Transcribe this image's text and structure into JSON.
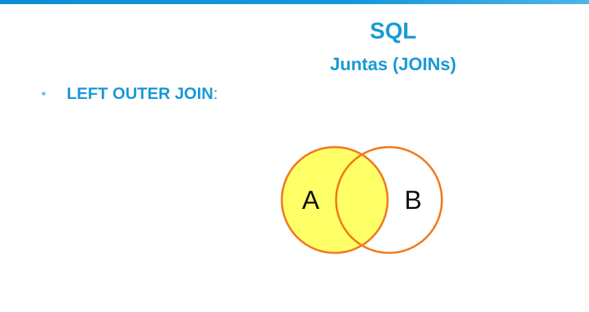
{
  "slide": {
    "title": "SQL",
    "subtitle": "Juntas (JOINs)",
    "bullet": {
      "marker": "•",
      "label": "LEFT OUTER JOIN",
      "suffix": ":"
    }
  },
  "diagram": {
    "set_a_label": "A",
    "set_b_label": "B",
    "highlighted": "A",
    "colors": {
      "fill_highlight": "#ffff66",
      "outline": "#f07a1e",
      "accent": "#1a9ad6",
      "bar": "#0a8fd6"
    }
  }
}
